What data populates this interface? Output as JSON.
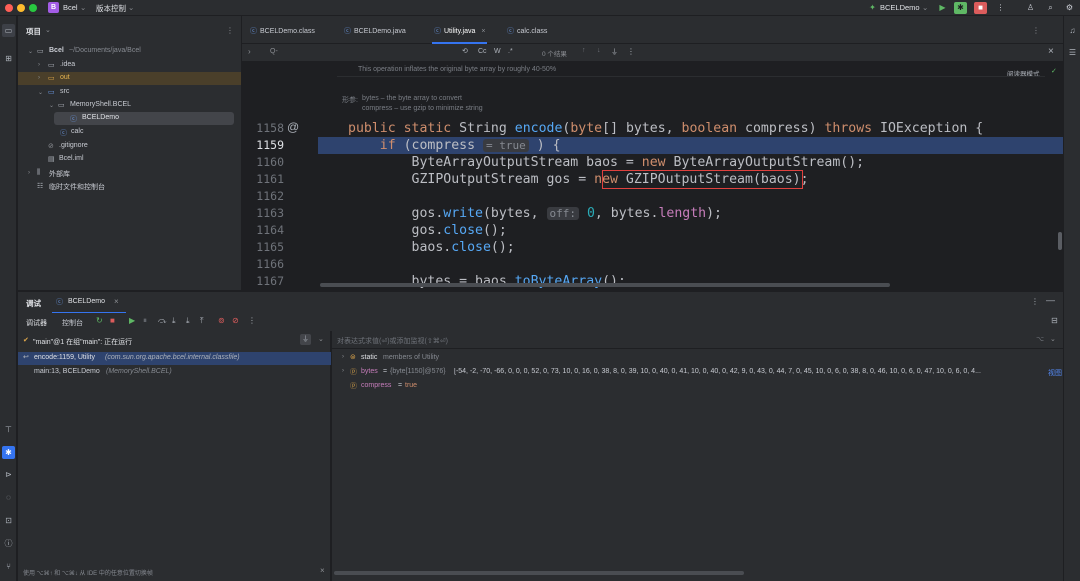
{
  "titlebar": {
    "project_badge": "B",
    "project_name": "Bcel",
    "vcs_label": "版本控制",
    "run_config": "BCELDemo"
  },
  "project_panel": {
    "title": "项目",
    "tree": [
      {
        "label": "Bcel",
        "sub": "~/Documents/java/Bcel"
      },
      {
        "label": ".idea"
      },
      {
        "label": "out"
      },
      {
        "label": "src"
      },
      {
        "label": "MemoryShell.BCEL"
      },
      {
        "label": "BCELDemo"
      },
      {
        "label": "calc"
      },
      {
        "label": ".gitignore"
      },
      {
        "label": "Bcel.iml"
      },
      {
        "label": "外部库"
      },
      {
        "label": "临时文件和控制台"
      }
    ]
  },
  "tabs": [
    {
      "label": "BCELDemo.class"
    },
    {
      "label": "BCELDemo.java"
    },
    {
      "label": "Utility.java"
    },
    {
      "label": "calc.class"
    }
  ],
  "find": {
    "placeholder": "Q-",
    "match_case": "Cc",
    "words": "W",
    "regex": ".*",
    "result_count": "0 个结果"
  },
  "editor": {
    "reader_mode": "阅读器模式",
    "doc_line1": "This operation inflates the original byte array by roughly 40-50%",
    "doc_param_label": "形参:",
    "doc_param1": "bytes – the byte array to convert",
    "doc_param2": "compress – use gzip to minimize string",
    "line_numbers": [
      "1158",
      "1159",
      "1160",
      "1161",
      "1162",
      "1163",
      "1164",
      "1165",
      "1166",
      "1167"
    ],
    "inline_hint_compress": "= true",
    "inline_hint_off": "off:"
  },
  "debug": {
    "panel_title": "调试",
    "session_tab": "BCELDemo",
    "subtab_debugger": "调试器",
    "subtab_console": "控制台",
    "thread_status": "\"main\"@1 在组\"main\": 正在运行",
    "frames": [
      {
        "method": "encode:1159, Utility",
        "class": "(com.sun.org.apache.bcel.internal.classfile)"
      },
      {
        "method": "main:13, BCELDemo",
        "class": "(MemoryShell.BCEL)"
      }
    ],
    "eval_placeholder": "对表达式求值(⏎)或添加监视(⇧⌘⏎)",
    "vars": [
      {
        "name": "static",
        "value": "members of Utility"
      },
      {
        "name": "bytes",
        "eq": "=",
        "type": "{byte[1150]@576}",
        "value": "[-54, -2, -70, -66, 0, 0, 0, 52, 0, 73, 10, 0, 16, 0, 38, 8, 0, 39, 10, 0, 40, 0, 41, 10, 0, 40, 0, 42, 9, 0, 43, 0, 44, 7, 0, 45, 10, 0, 6, 0, 38, 8, 0, 46, 10, 0, 6, 0, 47, 10, 0, 6, 0, 4...",
        "view": "视图"
      },
      {
        "name": "compress",
        "eq": "=",
        "value": "true"
      }
    ],
    "footer_hint": "使用 ⌥⌘↑ 和 ⌥⌘↓ 从 IDE 中的任意位置切换帧"
  },
  "colors": {
    "accent": "#3574f0",
    "selected_line": "#2e436e",
    "keyword": "#cf8e6d",
    "function": "#56a8f5",
    "field": "#c77dbb",
    "highlight_box": "#e0413e"
  }
}
